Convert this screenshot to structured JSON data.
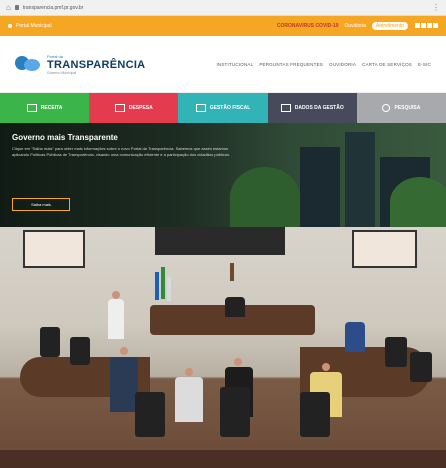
{
  "browser": {
    "url": "transparencia.pmf.pr.gov.br"
  },
  "topbar": {
    "left_text": "Portal Municipal",
    "covid": "CORONAVIRUS COVID-19",
    "link1": "Ouvidoria",
    "link2": "Atendimento"
  },
  "header": {
    "logo_small": "Portal da",
    "logo_big": "TRANSPARÊNCIA",
    "logo_sub": "Governo Municipal",
    "nav": [
      "INSTITUCIONAL",
      "PERGUNTAS FREQUENTES",
      "OUVIDORIA",
      "CARTA DE SERVIÇOS",
      "E-SIC"
    ]
  },
  "categories": [
    {
      "label": "RECEITA",
      "color": "#3bb54a"
    },
    {
      "label": "DESPESA",
      "color": "#e43b4e"
    },
    {
      "label": "GESTÃO FISCAL",
      "color": "#32b3b5"
    },
    {
      "label": "DADOS DA GESTÃO",
      "color": "#474a5a"
    },
    {
      "label": "PESQUISA",
      "color": "#a7a9ac"
    }
  ],
  "hero": {
    "title": "Governo mais Transparente",
    "desc": "Clique em \"Saiba mais\" para obter mais informações sobre o novo Portal da Transparência. Sabemos que assim estamos aplicando Políticas Públicas de Transparência, visando uma comunicação eficiente e a participação dos cidadãos públicos.",
    "button": "Saiba mais"
  }
}
